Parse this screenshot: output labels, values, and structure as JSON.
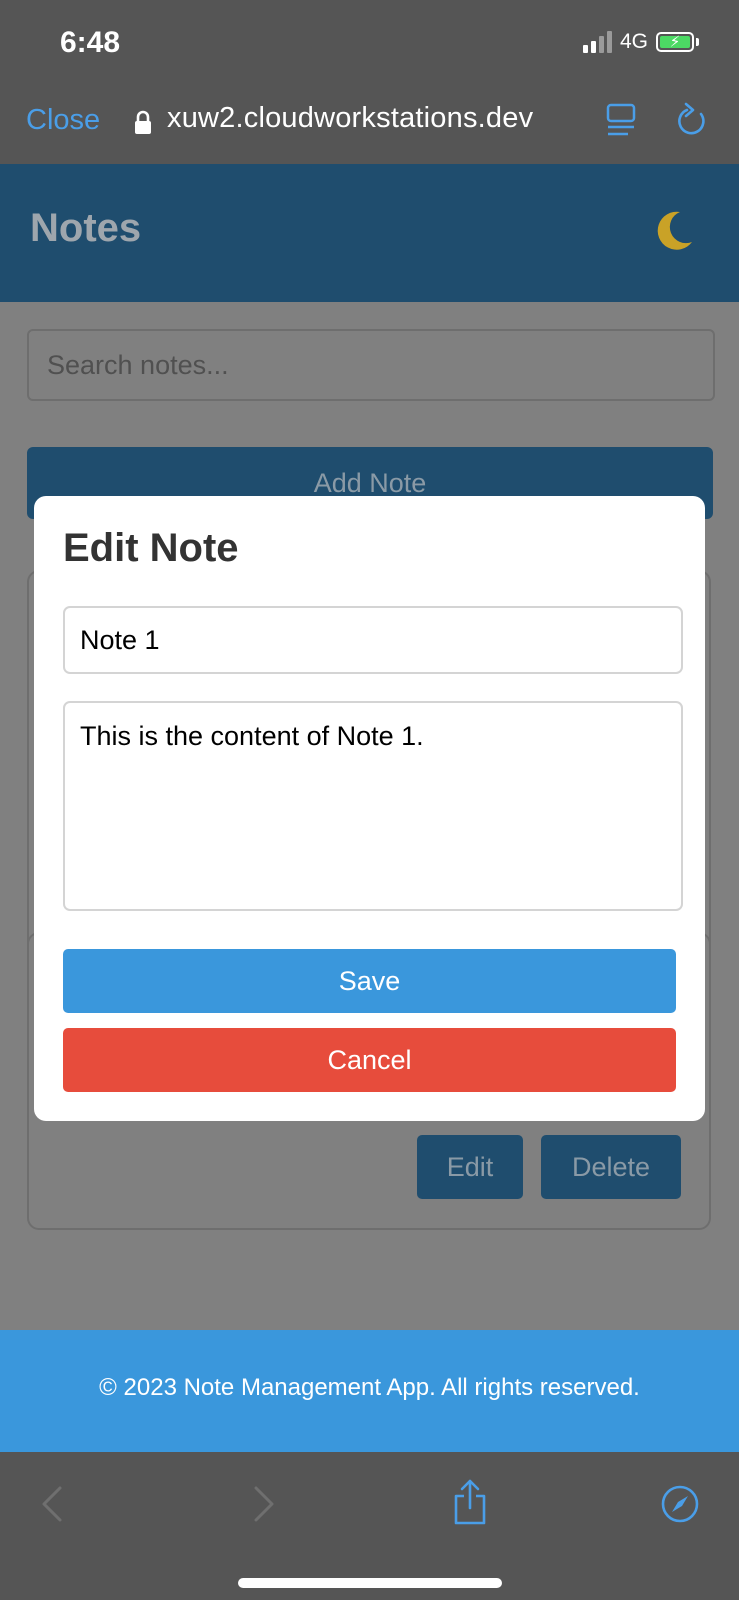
{
  "status_bar": {
    "time": "6:48",
    "network": "4G"
  },
  "browser": {
    "close_label": "Close",
    "url": "xuw2.cloudworkstations.dev",
    "accent_color": "#4a9ee8"
  },
  "app": {
    "title": "Notes",
    "search_placeholder": "Search notes...",
    "add_note_label": "Add Note",
    "card_buttons": {
      "edit_label": "Edit",
      "delete_label": "Delete"
    },
    "footer_text": "© 2023 Note Management App. All rights reserved.",
    "colors": {
      "header": "#1f4d6e",
      "footer": "#3a97dc",
      "save": "#3a97dc",
      "cancel": "#e74c3c"
    }
  },
  "modal": {
    "title": "Edit Note",
    "title_value": "Note 1",
    "content_value": "This is the content of Note 1.",
    "save_label": "Save",
    "cancel_label": "Cancel"
  },
  "icons": {
    "theme_toggle": "moon-icon",
    "toolbar": [
      "back-icon",
      "forward-icon",
      "share-icon",
      "compass-icon"
    ]
  }
}
